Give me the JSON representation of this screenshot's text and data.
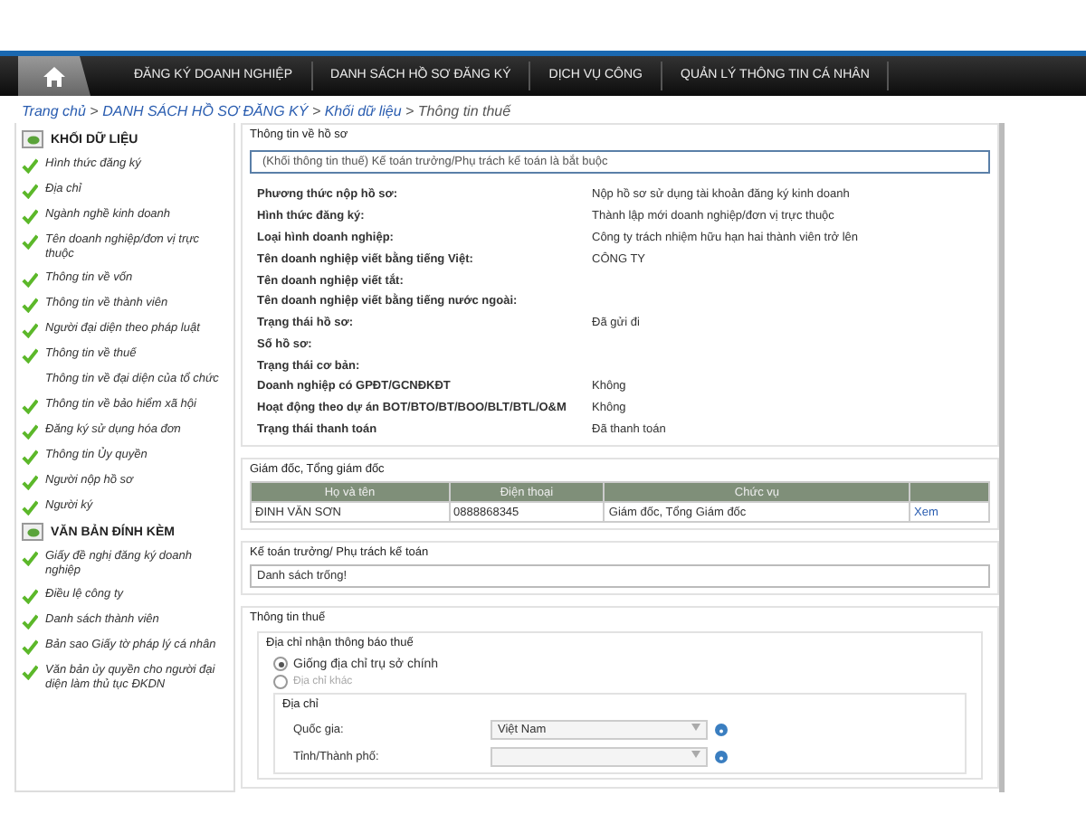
{
  "nav": {
    "items": [
      {
        "label": "ĐĂNG KÝ DOANH NGHIỆP",
        "selected": false
      },
      {
        "label": "DANH SÁCH HỒ SƠ ĐĂNG KÝ",
        "selected": false
      },
      {
        "label": "DỊCH VỤ CÔNG",
        "selected": false
      },
      {
        "label": "QUẢN LÝ THÔNG TIN CÁ NHÂN",
        "selected": false
      }
    ]
  },
  "breadcrumb": {
    "links": [
      "Trang chủ",
      "DANH SÁCH HỒ SƠ ĐĂNG KÝ",
      "Khối dữ liệu"
    ],
    "separator": ">",
    "current": "Thông tin thuế"
  },
  "sidebar": {
    "sections": [
      {
        "title": "KHỐI DỮ LIỆU",
        "items": [
          {
            "label": "Hình thức đăng ký",
            "checked": true
          },
          {
            "label": "Địa chỉ",
            "checked": true
          },
          {
            "label": "Ngành nghề kinh doanh",
            "checked": true
          },
          {
            "label": "Tên doanh nghiệp/đơn vị trực thuộc",
            "checked": true
          },
          {
            "label": "Thông tin về vốn",
            "checked": true
          },
          {
            "label": "Thông tin về thành viên",
            "checked": true
          },
          {
            "label": "Người đại diện theo pháp luật",
            "checked": true
          },
          {
            "label": "Thông tin về thuế",
            "checked": true
          },
          {
            "label": "Thông tin về đại diện của tổ chức",
            "checked": false
          },
          {
            "label": "Thông tin về bảo hiểm xã hội",
            "checked": true
          },
          {
            "label": "Đăng ký sử dụng hóa đơn",
            "checked": true
          },
          {
            "label": "Thông tin Ủy quyền",
            "checked": true
          },
          {
            "label": "Người nộp hồ sơ",
            "checked": true
          },
          {
            "label": "Người ký",
            "checked": true
          }
        ]
      },
      {
        "title": "VĂN BẢN ĐÍNH KÈM",
        "items": [
          {
            "label": "Giấy đề nghị đăng ký doanh nghiệp",
            "checked": true
          },
          {
            "label": "Điều lệ công ty",
            "checked": true
          },
          {
            "label": "Danh sách thành viên",
            "checked": true
          },
          {
            "label": "Bản sao Giấy tờ pháp lý cá nhân",
            "checked": true
          },
          {
            "label": "Văn bản ủy quyền cho người đại diện làm thủ tục ĐKDN",
            "checked": true
          }
        ]
      }
    ]
  },
  "record": {
    "title": "Thông tin về hồ sơ",
    "notice": "(Khối thông tin thuế) Kế toán trưởng/Phụ trách kế toán là bắt buộc",
    "fields": [
      {
        "label": "Phương thức nộp hồ sơ:",
        "value": "Nộp hồ sơ sử dụng tài khoản đăng ký kinh doanh"
      },
      {
        "label": "Hình thức đăng ký:",
        "value": "Thành lập mới doanh nghiệp/đơn vị trực thuộc"
      },
      {
        "label": "Loại hình doanh nghiệp:",
        "value": "Công ty trách nhiệm hữu hạn hai thành viên trở lên"
      },
      {
        "label": "Tên doanh nghiệp viết bằng tiếng Việt:",
        "value": "CÔNG TY"
      },
      {
        "label": "Tên doanh nghiệp viết tắt:"
      },
      {
        "label": "Tên doanh nghiệp viết bằng tiếng nước ngoài:"
      },
      {
        "label": "Trạng thái hồ sơ:",
        "value": "Đã gửi đi"
      },
      {
        "label": "Số hồ sơ:"
      },
      {
        "label": "Trạng thái cơ bản:"
      },
      {
        "label": "Doanh nghiệp có GPĐT/GCNĐKĐT",
        "value": "Không"
      },
      {
        "label": "Hoạt động theo dự án BOT/BTO/BT/BOO/BLT/BTL/O&M",
        "value": "Không"
      },
      {
        "label": "Trạng thái thanh toán",
        "value": "Đã thanh toán"
      }
    ]
  },
  "directors": {
    "title": "Giám đốc, Tổng giám đốc",
    "columns": [
      "Họ và tên",
      "Điện thoại",
      "Chức vụ"
    ],
    "rows": [
      {
        "cells": [
          "ĐINH VĂN SƠN",
          "0888868345",
          "Giám đốc, Tổng Giám đốc"
        ],
        "link": "Xem"
      }
    ]
  },
  "accountant": {
    "title": "Kế toán trưởng/ Phụ trách kế toán",
    "empty_text": "Danh sách trống!"
  },
  "tax": {
    "title": "Thông tin thuế",
    "notice_address": {
      "title": "Địa chỉ nhận thông báo thuế",
      "options": [
        {
          "label": "Giống địa chỉ trụ sở chính",
          "selected": true
        },
        {
          "label": "Địa chỉ khác",
          "selected": false
        }
      ]
    },
    "address": {
      "title": "Địa chỉ",
      "fields": [
        {
          "label": "Quốc gia:",
          "value": "Việt Nam"
        },
        {
          "label": "Tỉnh/Thành phố:"
        }
      ]
    }
  }
}
